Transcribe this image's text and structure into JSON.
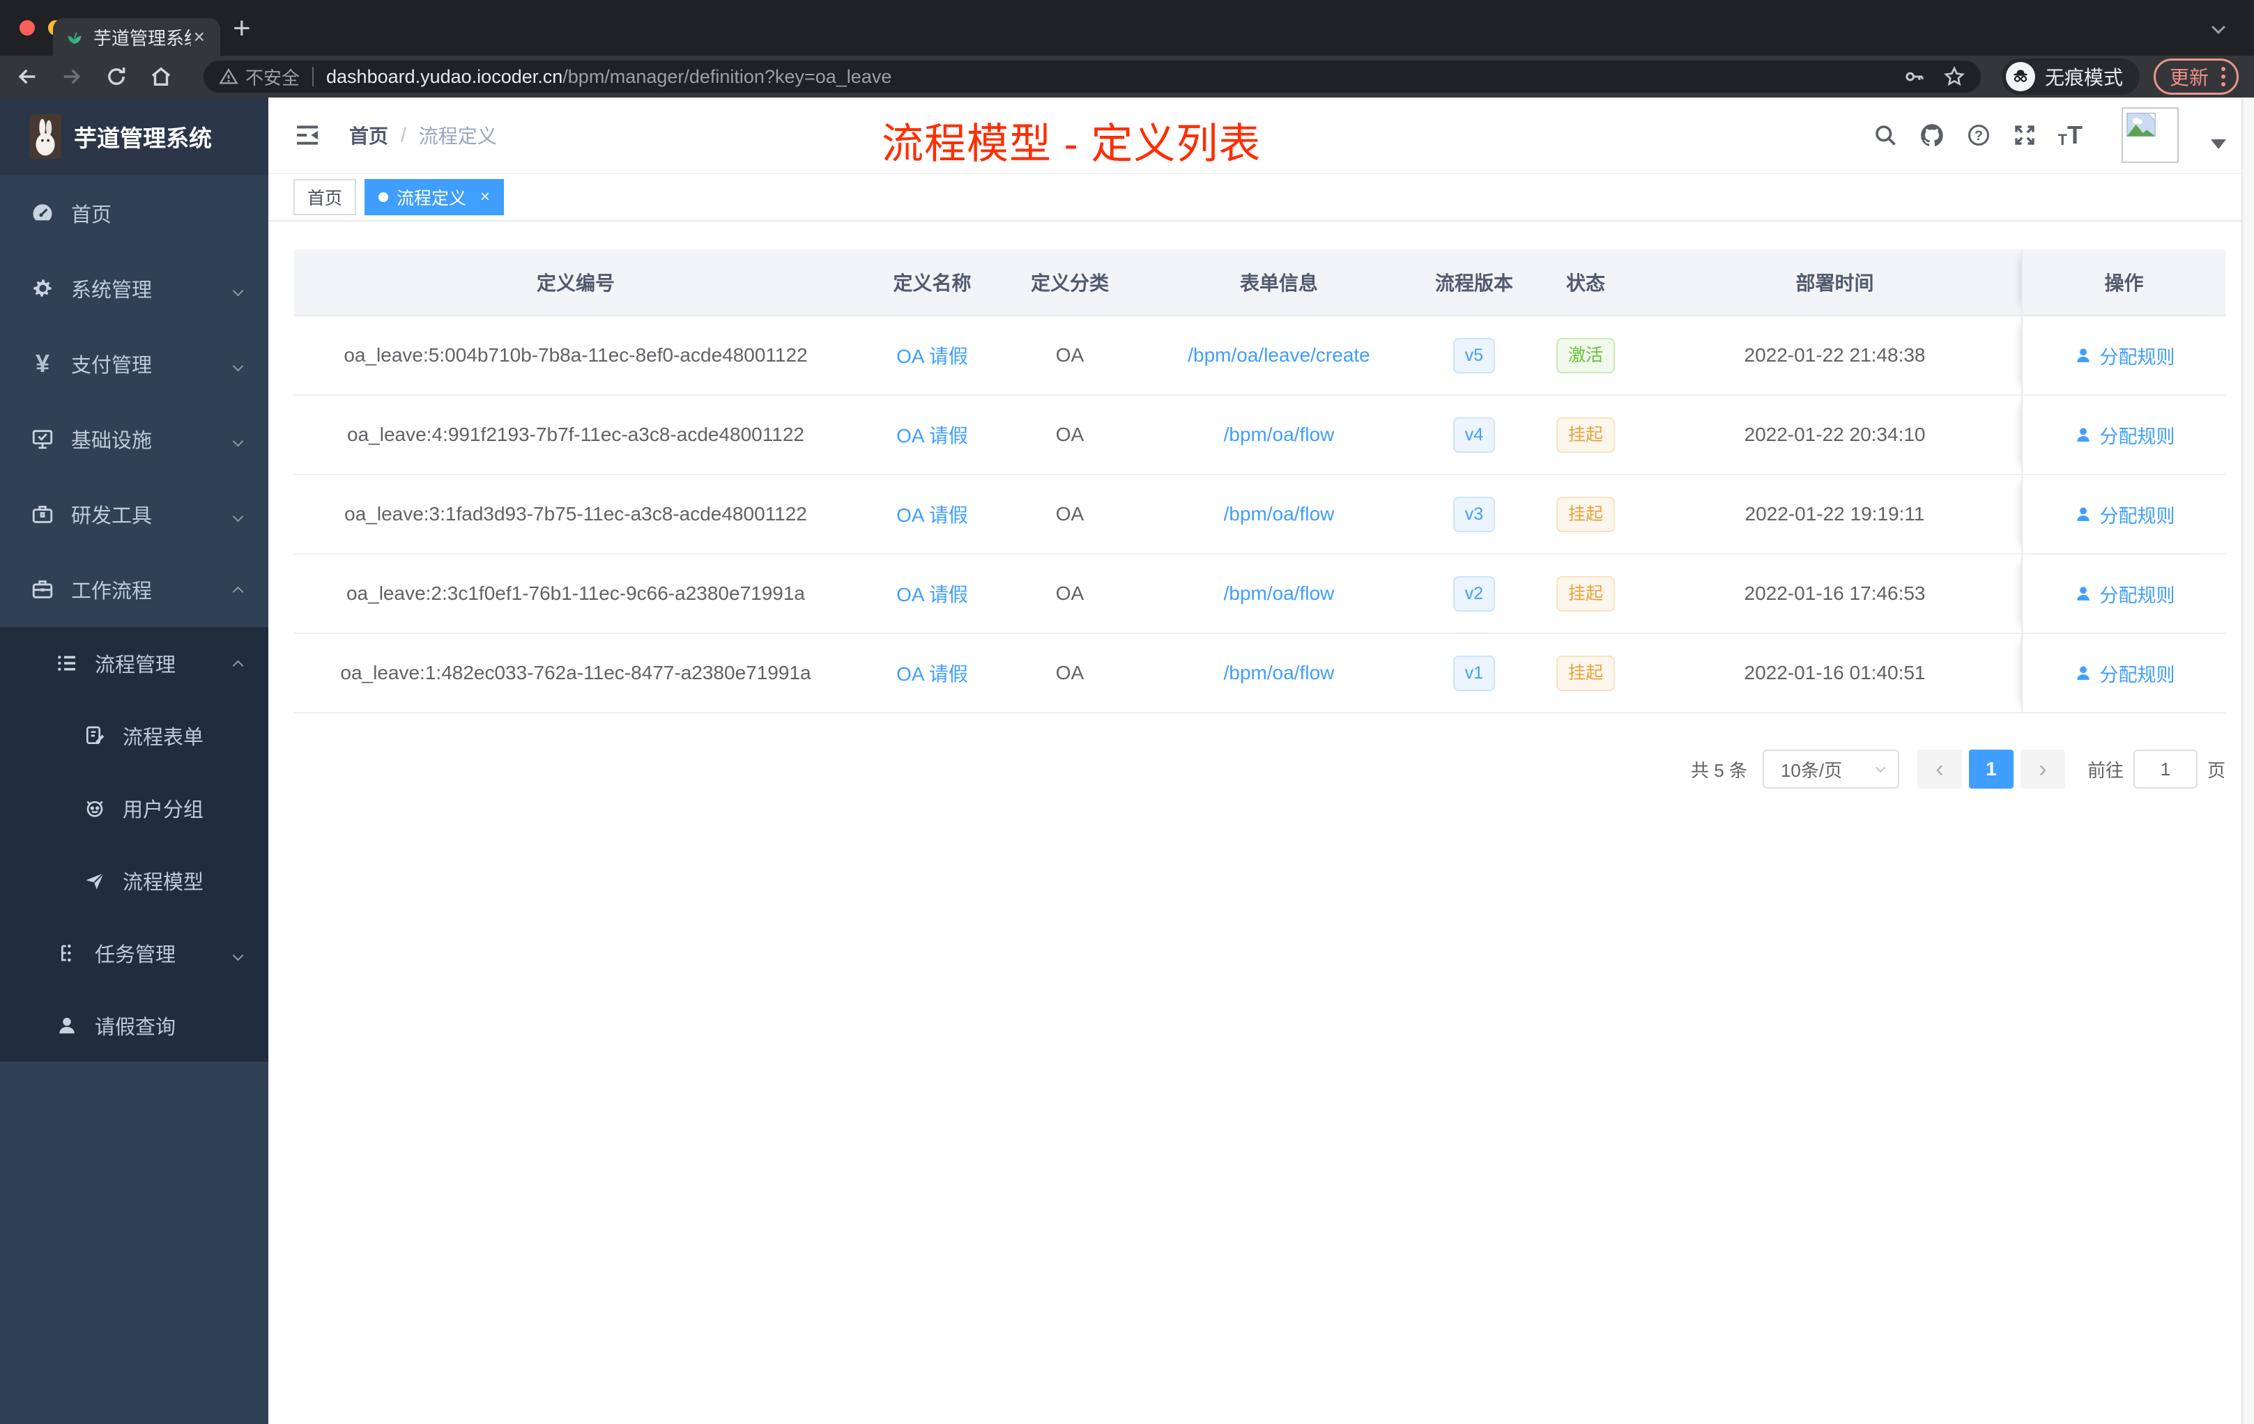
{
  "browser": {
    "tab": {
      "title": "芋道管理系统",
      "close": "×",
      "favicon": "seedling-icon"
    },
    "new_tab": "+",
    "traffic_lights": [
      "#ff5f57",
      "#febc2e",
      "#28c840"
    ],
    "address_bar": {
      "security_warning": "不安全",
      "url_host": "dashboard.yudao.iocoder.cn",
      "url_path": "/bpm/manager/definition?key=oa_leave",
      "incognito_label": "无痕模式",
      "update_button": "更新"
    }
  },
  "sidebar": {
    "logo_title": "芋道管理系统",
    "items": [
      {
        "label": "首页",
        "icon": "dashboard-icon"
      },
      {
        "label": "系统管理",
        "icon": "gear-icon",
        "chevron": "down"
      },
      {
        "label": "支付管理",
        "icon": "yen-icon",
        "chevron": "down"
      },
      {
        "label": "基础设施",
        "icon": "monitor-icon",
        "chevron": "down"
      },
      {
        "label": "研发工具",
        "icon": "toolbox-icon",
        "chevron": "down"
      },
      {
        "label": "工作流程",
        "icon": "briefcase-icon",
        "chevron": "up"
      }
    ],
    "workflow_children": [
      {
        "label": "流程管理",
        "icon": "list-icon",
        "chevron": "up"
      },
      {
        "label": "流程表单",
        "icon": "form-icon"
      },
      {
        "label": "用户分组",
        "icon": "group-icon"
      },
      {
        "label": "流程模型",
        "icon": "send-icon"
      },
      {
        "label": "任务管理",
        "icon": "tree-icon",
        "chevron": "down"
      },
      {
        "label": "请假查询",
        "icon": "user-icon"
      }
    ]
  },
  "header": {
    "breadcrumb": {
      "home": "首页",
      "separator": "/",
      "current": "流程定义"
    },
    "overlay_title": "流程模型 - 定义列表",
    "overlay_color": "#ff2d00"
  },
  "tags": [
    {
      "label": "首页",
      "active": false
    },
    {
      "label": "流程定义",
      "active": true,
      "close": "×"
    }
  ],
  "table": {
    "columns": [
      "定义编号",
      "定义名称",
      "定义分类",
      "表单信息",
      "流程版本",
      "状态",
      "部署时间",
      "操作"
    ],
    "rows": [
      {
        "id": "oa_leave:5:004b710b-7b8a-11ec-8ef0-acde48001122",
        "name": "OA 请假",
        "category": "OA",
        "form": "/bpm/oa/leave/create",
        "version": "v5",
        "status": "激活",
        "status_type": "success",
        "time": "2022-01-22 21:48:38",
        "action": "分配规则"
      },
      {
        "id": "oa_leave:4:991f2193-7b7f-11ec-a3c8-acde48001122",
        "name": "OA 请假",
        "category": "OA",
        "form": "/bpm/oa/flow",
        "version": "v4",
        "status": "挂起",
        "status_type": "warning",
        "time": "2022-01-22 20:34:10",
        "action": "分配规则"
      },
      {
        "id": "oa_leave:3:1fad3d93-7b75-11ec-a3c8-acde48001122",
        "name": "OA 请假",
        "category": "OA",
        "form": "/bpm/oa/flow",
        "version": "v3",
        "status": "挂起",
        "status_type": "warning",
        "time": "2022-01-22 19:19:11",
        "action": "分配规则"
      },
      {
        "id": "oa_leave:2:3c1f0ef1-76b1-11ec-9c66-a2380e71991a",
        "name": "OA 请假",
        "category": "OA",
        "form": "/bpm/oa/flow",
        "version": "v2",
        "status": "挂起",
        "status_type": "warning",
        "time": "2022-01-16 17:46:53",
        "action": "分配规则"
      },
      {
        "id": "oa_leave:1:482ec033-762a-11ec-8477-a2380e71991a",
        "name": "OA 请假",
        "category": "OA",
        "form": "/bpm/oa/flow",
        "version": "v1",
        "status": "挂起",
        "status_type": "warning",
        "time": "2022-01-16 01:40:51",
        "action": "分配规则"
      }
    ]
  },
  "pagination": {
    "total": "共 5 条",
    "page_size": "10条/页",
    "prev": "‹",
    "current": "1",
    "next": "›",
    "goto_label": "前往",
    "goto_value": "1",
    "unit": "页"
  },
  "colors": {
    "accent": "#409eff",
    "success": "#67c23a",
    "warning": "#e6a23c",
    "sidebar_bg": "#304156",
    "submenu_bg": "#1f2d3d",
    "title_red": "#ff2d00"
  }
}
